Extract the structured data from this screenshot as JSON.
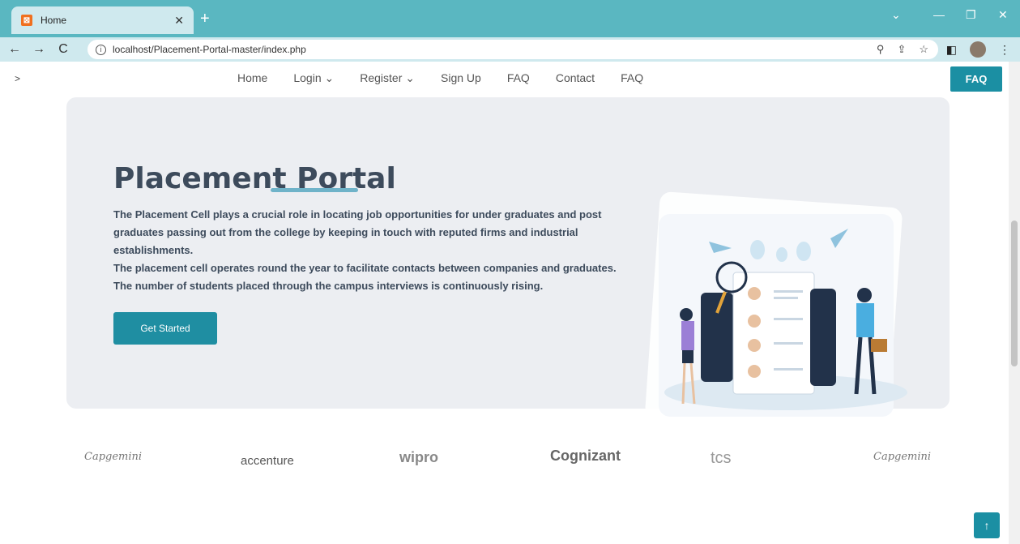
{
  "browser": {
    "tab_title": "Home",
    "url": "localhost/Placement-Portal-master/index.php"
  },
  "nav": {
    "items": [
      "Home",
      "Login ⌄",
      "Register ⌄",
      "Sign Up",
      "FAQ",
      "Contact",
      "FAQ"
    ],
    "faq_button": "FAQ",
    "chevron": ">"
  },
  "hero": {
    "title": "Placement Portal",
    "paragraph1": "The Placement Cell plays a crucial role in locating job opportunities for under graduates and post graduates passing out from the college by keeping in touch with reputed firms and industrial establishments.",
    "paragraph2": "The placement cell operates round the year to facilitate contacts between companies and graduates.",
    "paragraph3": "The number of students placed through the campus interviews is continuously rising.",
    "cta_label": "Get Started"
  },
  "logos": [
    "Capgemini",
    "accenture",
    "wipro",
    "Cognizant",
    "tcs",
    "Capgemini"
  ],
  "colors": {
    "accent": "#1b8fa3",
    "tabbar": "#5ab7c1",
    "hero_bg": "#eceef2"
  }
}
